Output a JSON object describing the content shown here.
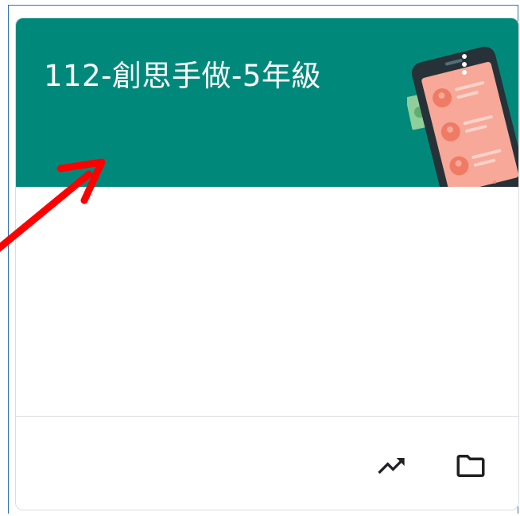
{
  "card": {
    "title": "112-創思手做-5年級",
    "header_color": "#00897b",
    "actions": {
      "trends_icon": "trending-up-icon",
      "folder_icon": "folder-icon"
    }
  },
  "annotation": {
    "arrow_color": "#ff0000"
  }
}
